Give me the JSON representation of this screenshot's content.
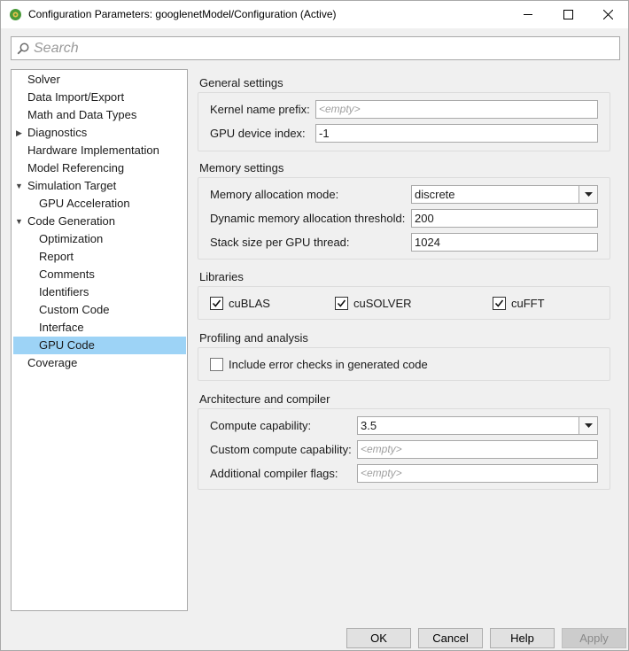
{
  "window": {
    "title": "Configuration Parameters: googlenetModel/Configuration (Active)"
  },
  "search": {
    "placeholder": "Search"
  },
  "tree": {
    "items": [
      {
        "label": "Solver"
      },
      {
        "label": "Data Import/Export"
      },
      {
        "label": "Math and Data Types"
      },
      {
        "label": "Diagnostics",
        "expander": "collapsed"
      },
      {
        "label": "Hardware Implementation"
      },
      {
        "label": "Model Referencing"
      },
      {
        "label": "Simulation Target",
        "expander": "expanded"
      },
      {
        "label": "GPU Acceleration"
      },
      {
        "label": "Code Generation",
        "expander": "expanded"
      },
      {
        "label": "Optimization"
      },
      {
        "label": "Report"
      },
      {
        "label": "Comments"
      },
      {
        "label": "Identifiers"
      },
      {
        "label": "Custom Code"
      },
      {
        "label": "Interface"
      },
      {
        "label": "GPU Code",
        "selected": true
      },
      {
        "label": "Coverage"
      }
    ]
  },
  "general": {
    "title": "General settings",
    "kernel_prefix_label": "Kernel name prefix:",
    "kernel_prefix_value": "<empty>",
    "gpu_index_label": "GPU device index:",
    "gpu_index_value": "-1"
  },
  "memory": {
    "title": "Memory settings",
    "alloc_mode_label": "Memory allocation mode:",
    "alloc_mode_value": "discrete",
    "dyn_threshold_label": "Dynamic memory allocation threshold:",
    "dyn_threshold_value": "200",
    "stack_size_label": "Stack size per GPU thread:",
    "stack_size_value": "1024"
  },
  "libraries": {
    "title": "Libraries",
    "cublas": {
      "label": "cuBLAS",
      "checked": true
    },
    "cusolver": {
      "label": "cuSOLVER",
      "checked": true
    },
    "cufft": {
      "label": "cuFFT",
      "checked": true
    }
  },
  "profiling": {
    "title": "Profiling and analysis",
    "error_checks": {
      "label": "Include error checks in generated code",
      "checked": false
    }
  },
  "architecture": {
    "title": "Architecture and compiler",
    "compute_cap_label": "Compute capability:",
    "compute_cap_value": "3.5",
    "custom_cap_label": "Custom compute capability:",
    "custom_cap_value": "<empty>",
    "compiler_flags_label": "Additional compiler flags:",
    "compiler_flags_value": "<empty>"
  },
  "buttons": {
    "ok": "OK",
    "cancel": "Cancel",
    "help": "Help",
    "apply": "Apply"
  },
  "colors": {
    "selection": "#9dd3f6",
    "app_icon": "#4a9a3a"
  }
}
